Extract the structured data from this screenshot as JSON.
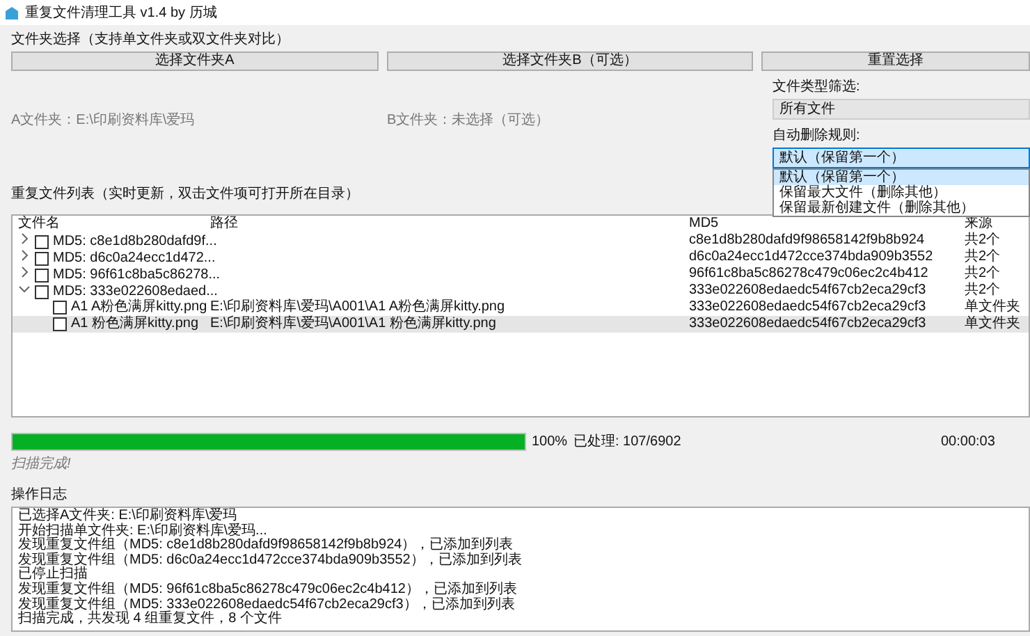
{
  "window": {
    "title": "重复文件清理工具 v1.4 by 历城"
  },
  "folder_section": {
    "title": "文件夹选择（支持单文件夹或双文件夹对比）",
    "buttons": [
      "选择文件夹A",
      "选择文件夹B（可选）",
      "重置选择"
    ],
    "folder_a": "A文件夹：E:\\印刷资料库\\爱玛",
    "folder_b": "B文件夹：未选择（可选）"
  },
  "filters": {
    "type_label": "文件类型筛选:",
    "type_value": "所有文件",
    "rule_label": "自动删除规则:",
    "rule_value": "默认（保留第一个）",
    "rule_expanded": true,
    "rule_options": [
      {
        "label": "默认（保留第一个）",
        "selected": true
      },
      {
        "label": "保留最大文件（删除其他）",
        "selected": false
      },
      {
        "label": "保留最新创建文件（删除其他）",
        "selected": false
      }
    ]
  },
  "list_section": {
    "title": "重复文件列表（实时更新，双击文件项可打开所在目录）"
  },
  "table": {
    "columns": [
      "文件名",
      "路径",
      "MD5",
      "来源"
    ],
    "rows": [
      {
        "name": "MD5: c8e1d8b280dafd9f...",
        "md5": "c8e1d8b280dafd9f98658142f9b8b924",
        "source": "共2个",
        "expanded": false,
        "checked": false,
        "selected": false,
        "children": []
      },
      {
        "name": "MD5: d6c0a24ecc1d472...",
        "md5": "d6c0a24ecc1d472cce374bda909b3552",
        "source": "共2个",
        "expanded": false,
        "checked": false,
        "selected": false,
        "children": []
      },
      {
        "name": "MD5: 96f61c8ba5c86278...",
        "md5": "96f61c8ba5c86278c479c06ec2c4b412",
        "source": "共2个",
        "expanded": false,
        "checked": false,
        "selected": false,
        "children": []
      },
      {
        "name": "MD5: 333e022608edaed...",
        "md5": "333e022608edaedc54f67cb2eca29cf3",
        "source": "共2个",
        "expanded": true,
        "checked": false,
        "selected": false,
        "children": [
          {
            "name": "A1 A粉色满屏kitty.png",
            "path": "E:\\印刷资料库\\爱玛\\A001\\A1 A粉色满屏kitty.png",
            "md5": "333e022608edaedc54f67cb2eca29cf3",
            "source": "单文件夹",
            "checked": false,
            "selected": false
          },
          {
            "name": "A1 粉色满屏kitty.png",
            "path": "E:\\印刷资料库\\爱玛\\A001\\A1 粉色满屏kitty.png",
            "md5": "333e022608edaedc54f67cb2eca29cf3",
            "source": "单文件夹",
            "checked": false,
            "selected": true
          }
        ]
      }
    ]
  },
  "progress": {
    "level": 1.0,
    "percent": "100%",
    "processed": "已处理: 107/6902",
    "elapsed": "00:00:03",
    "status": "扫描完成!"
  },
  "log": {
    "title": "操作日志",
    "lines": [
      "已选择A文件夹: E:\\印刷资料库\\爱玛",
      "开始扫描单文件夹: E:\\印刷资料库\\爱玛...",
      "发现重复文件组（MD5: c8e1d8b280dafd9f98658142f9b8b924），已添加到列表",
      "发现重复文件组（MD5: d6c0a24ecc1d472cce374bda909b3552），已添加到列表",
      "已停止扫描",
      "发现重复文件组（MD5: 96f61c8ba5c86278c479c06ec2c4b412），已添加到列表",
      "发现重复文件组（MD5: 333e022608edaedc54f67cb2eca29cf3），已添加到列表",
      "扫描完成，共发现 4 组重复文件，8 个文件"
    ]
  }
}
